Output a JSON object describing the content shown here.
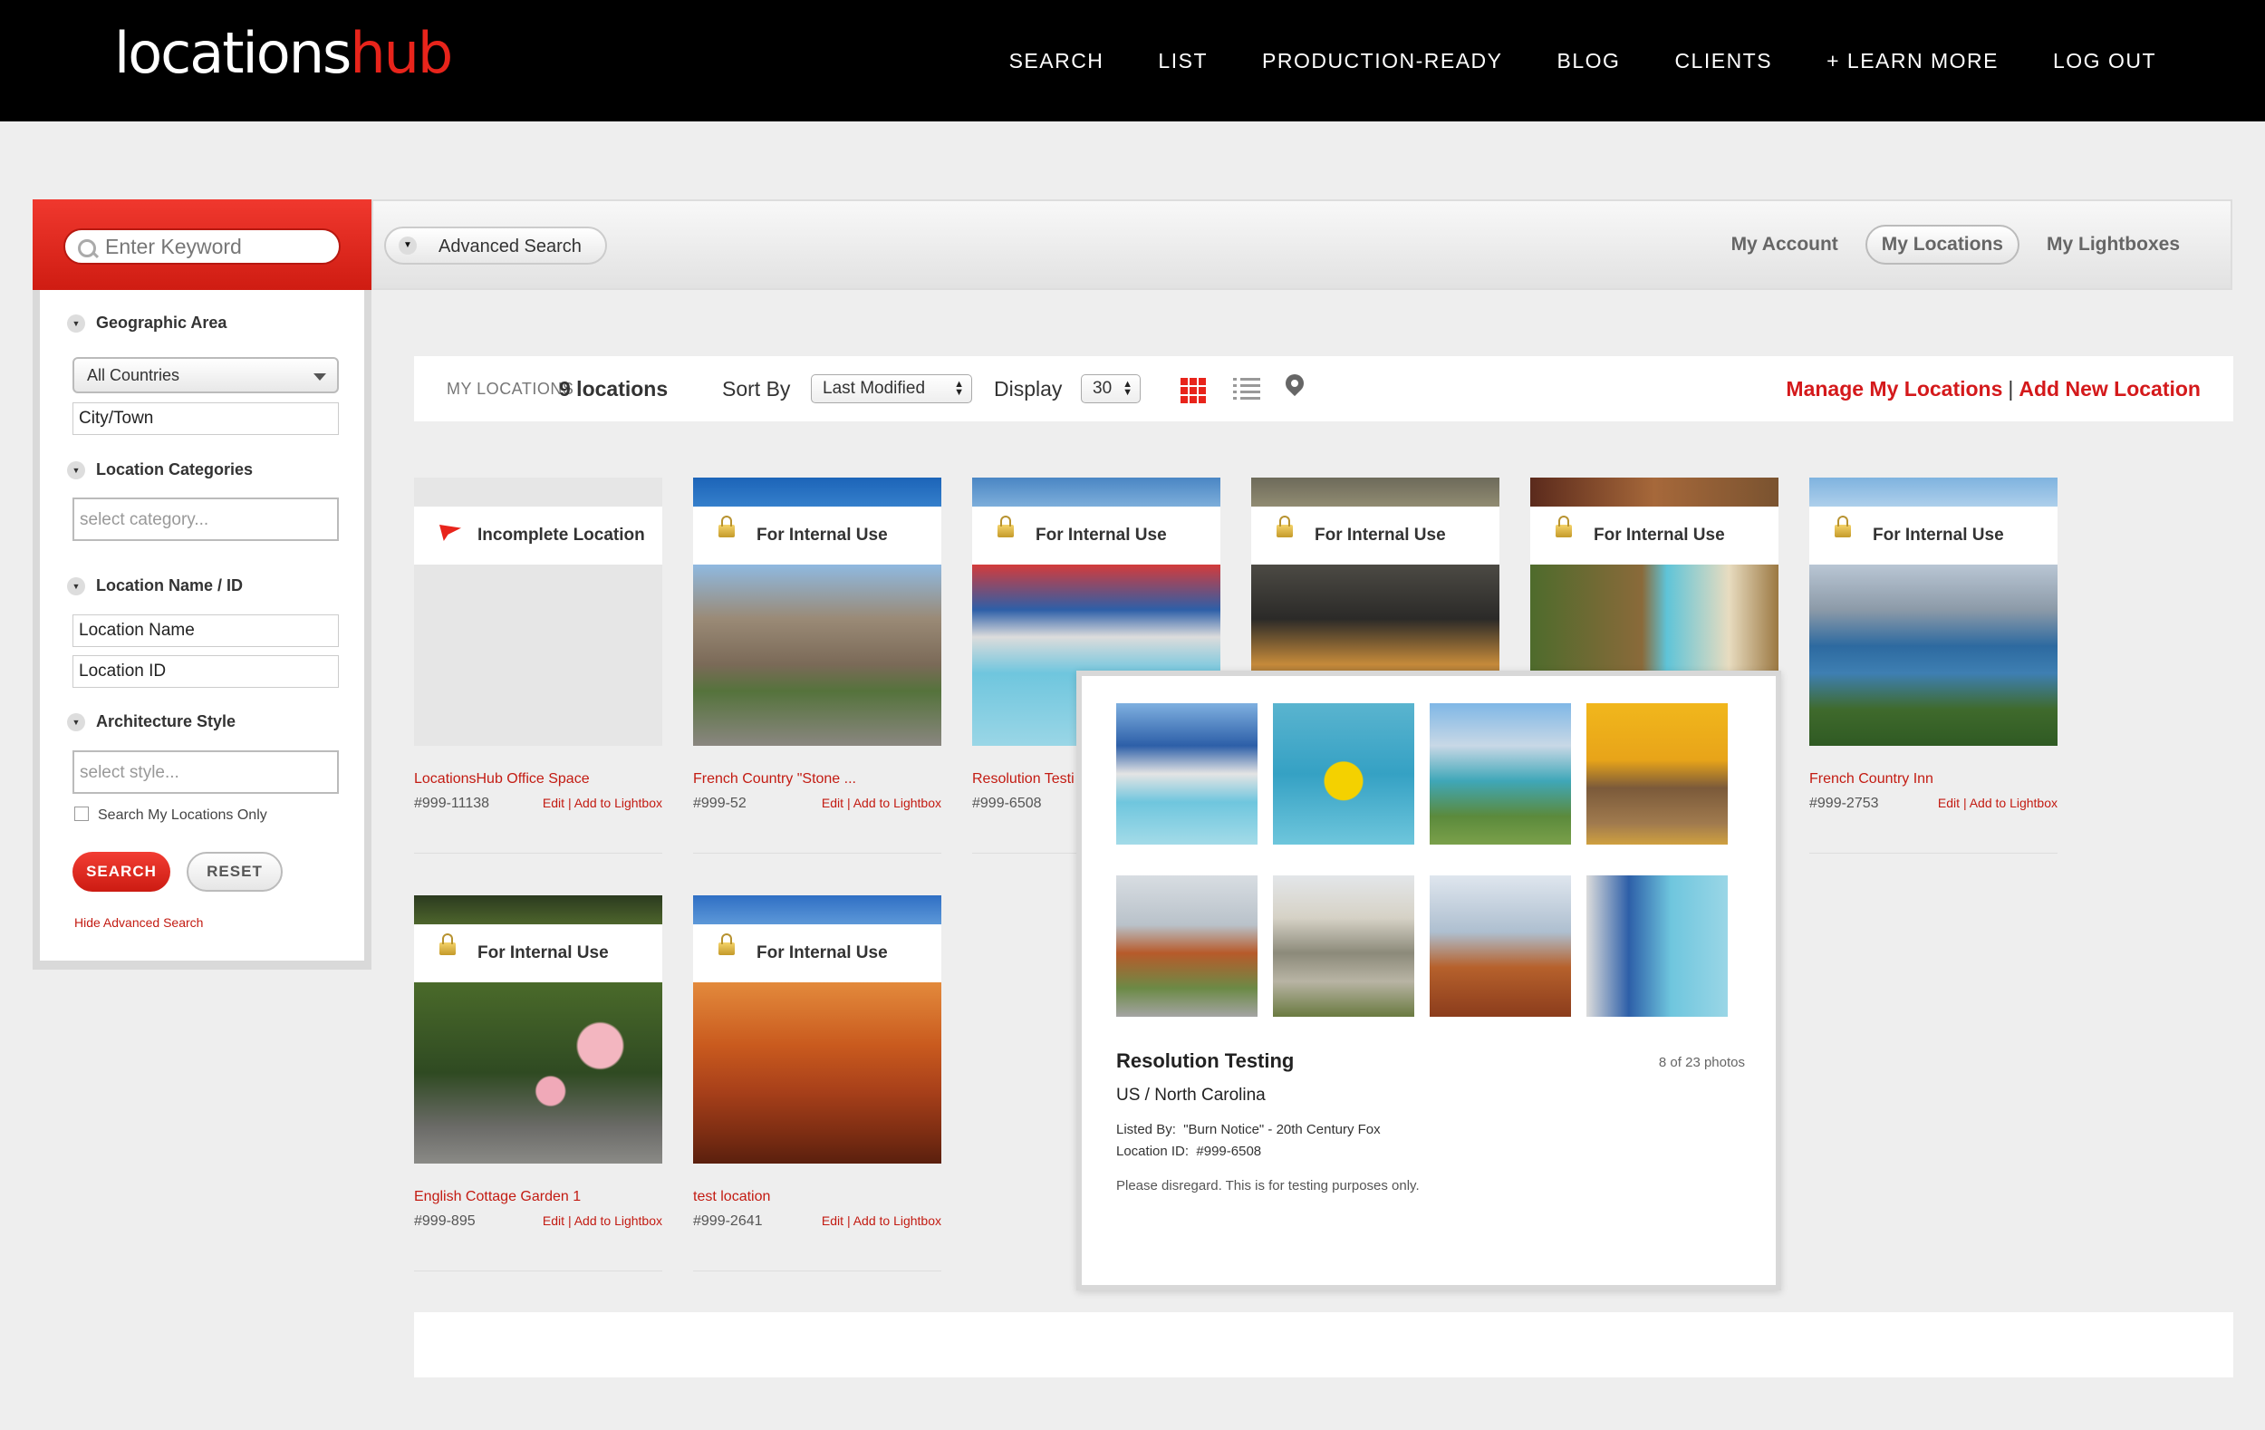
{
  "brand": {
    "logo_part1": "locations",
    "logo_part2": "hub"
  },
  "nav": [
    "SEARCH",
    "LIST",
    "PRODUCTION-READY",
    "BLOG",
    "CLIENTS",
    "+ LEARN MORE",
    "LOG OUT"
  ],
  "search": {
    "keyword_placeholder": "Enter Keyword",
    "advanced_label": "Advanced Search"
  },
  "account_links": {
    "account": "My Account",
    "locations": "My Locations",
    "lightboxes": "My Lightboxes"
  },
  "sidebar": {
    "geo_label": "Geographic Area",
    "country": "All Countries",
    "city": "City/Town",
    "cat_label": "Location Categories",
    "cat_placeholder": "select category...",
    "name_label": "Location Name / ID",
    "loc_name": "Location Name",
    "loc_id": "Location ID",
    "arch_label": "Architecture Style",
    "arch_placeholder": "select style...",
    "only_mine": "Search My Locations Only",
    "search_btn": "SEARCH",
    "reset_btn": "RESET",
    "hide_adv": "Hide Advanced Search"
  },
  "toolbar": {
    "my_locations": "MY LOCATIONS",
    "count": "9 locations",
    "sort_label": "Sort By",
    "sort_value": "Last Modified",
    "display_label": "Display",
    "display_value": "30",
    "manage": "Manage My Locations",
    "separator": "|",
    "add_new": "Add New Location"
  },
  "card_actions": {
    "edit": "Edit",
    "sep": "|",
    "lightbox": "Add to Lightbox"
  },
  "cards": [
    {
      "band": "Incomplete Location",
      "title": "LocationsHub Office Space",
      "id": "#999-11138"
    },
    {
      "band": "For Internal Use",
      "title": "French Country \"Stone ...",
      "id": "#999-52"
    },
    {
      "band": "For Internal Use",
      "title": "Resolution Testi",
      "id": "#999-6508"
    },
    {
      "band": "For Internal Use",
      "title": "",
      "id": ""
    },
    {
      "band": "For Internal Use",
      "title": "",
      "id": ""
    },
    {
      "band": "For Internal Use",
      "title": "French Country Inn",
      "id": "#999-2753"
    },
    {
      "band": "For Internal Use",
      "title": "English Cottage Garden 1",
      "id": "#999-895"
    },
    {
      "band": "For Internal Use",
      "title": "test location",
      "id": "#999-2641"
    }
  ],
  "popup": {
    "title": "Resolution Testing",
    "photo_count": "8 of 23 photos",
    "location": "US / North Carolina",
    "listed_by_label": "Listed By:",
    "listed_by": "\"Burn Notice\" - 20th Century Fox",
    "loc_id_label": "Location ID:",
    "loc_id": "#999-6508",
    "description": "Please disregard. This is for testing purposes only."
  },
  "colors": {
    "accent": "#e8241b",
    "link_red": "#c31b12",
    "nav_bg": "#000000"
  }
}
